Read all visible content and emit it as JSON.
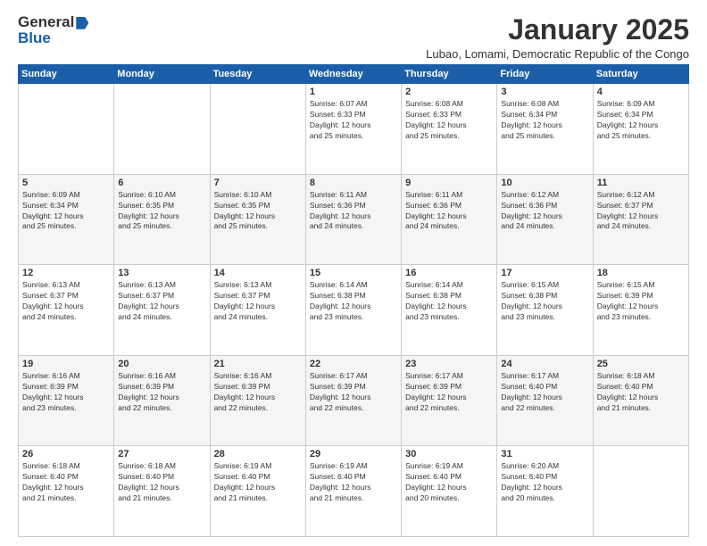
{
  "header": {
    "logo_general": "General",
    "logo_blue": "Blue",
    "title": "January 2025",
    "subtitle": "Lubao, Lomami, Democratic Republic of the Congo"
  },
  "calendar": {
    "days_of_week": [
      "Sunday",
      "Monday",
      "Tuesday",
      "Wednesday",
      "Thursday",
      "Friday",
      "Saturday"
    ],
    "weeks": [
      [
        {
          "day": "",
          "info": ""
        },
        {
          "day": "",
          "info": ""
        },
        {
          "day": "",
          "info": ""
        },
        {
          "day": "1",
          "info": "Sunrise: 6:07 AM\nSunset: 6:33 PM\nDaylight: 12 hours\nand 25 minutes."
        },
        {
          "day": "2",
          "info": "Sunrise: 6:08 AM\nSunset: 6:33 PM\nDaylight: 12 hours\nand 25 minutes."
        },
        {
          "day": "3",
          "info": "Sunrise: 6:08 AM\nSunset: 6:34 PM\nDaylight: 12 hours\nand 25 minutes."
        },
        {
          "day": "4",
          "info": "Sunrise: 6:09 AM\nSunset: 6:34 PM\nDaylight: 12 hours\nand 25 minutes."
        }
      ],
      [
        {
          "day": "5",
          "info": "Sunrise: 6:09 AM\nSunset: 6:34 PM\nDaylight: 12 hours\nand 25 minutes."
        },
        {
          "day": "6",
          "info": "Sunrise: 6:10 AM\nSunset: 6:35 PM\nDaylight: 12 hours\nand 25 minutes."
        },
        {
          "day": "7",
          "info": "Sunrise: 6:10 AM\nSunset: 6:35 PM\nDaylight: 12 hours\nand 25 minutes."
        },
        {
          "day": "8",
          "info": "Sunrise: 6:11 AM\nSunset: 6:36 PM\nDaylight: 12 hours\nand 24 minutes."
        },
        {
          "day": "9",
          "info": "Sunrise: 6:11 AM\nSunset: 6:36 PM\nDaylight: 12 hours\nand 24 minutes."
        },
        {
          "day": "10",
          "info": "Sunrise: 6:12 AM\nSunset: 6:36 PM\nDaylight: 12 hours\nand 24 minutes."
        },
        {
          "day": "11",
          "info": "Sunrise: 6:12 AM\nSunset: 6:37 PM\nDaylight: 12 hours\nand 24 minutes."
        }
      ],
      [
        {
          "day": "12",
          "info": "Sunrise: 6:13 AM\nSunset: 6:37 PM\nDaylight: 12 hours\nand 24 minutes."
        },
        {
          "day": "13",
          "info": "Sunrise: 6:13 AM\nSunset: 6:37 PM\nDaylight: 12 hours\nand 24 minutes."
        },
        {
          "day": "14",
          "info": "Sunrise: 6:13 AM\nSunset: 6:37 PM\nDaylight: 12 hours\nand 24 minutes."
        },
        {
          "day": "15",
          "info": "Sunrise: 6:14 AM\nSunset: 6:38 PM\nDaylight: 12 hours\nand 23 minutes."
        },
        {
          "day": "16",
          "info": "Sunrise: 6:14 AM\nSunset: 6:38 PM\nDaylight: 12 hours\nand 23 minutes."
        },
        {
          "day": "17",
          "info": "Sunrise: 6:15 AM\nSunset: 6:38 PM\nDaylight: 12 hours\nand 23 minutes."
        },
        {
          "day": "18",
          "info": "Sunrise: 6:15 AM\nSunset: 6:39 PM\nDaylight: 12 hours\nand 23 minutes."
        }
      ],
      [
        {
          "day": "19",
          "info": "Sunrise: 6:16 AM\nSunset: 6:39 PM\nDaylight: 12 hours\nand 23 minutes."
        },
        {
          "day": "20",
          "info": "Sunrise: 6:16 AM\nSunset: 6:39 PM\nDaylight: 12 hours\nand 22 minutes."
        },
        {
          "day": "21",
          "info": "Sunrise: 6:16 AM\nSunset: 6:39 PM\nDaylight: 12 hours\nand 22 minutes."
        },
        {
          "day": "22",
          "info": "Sunrise: 6:17 AM\nSunset: 6:39 PM\nDaylight: 12 hours\nand 22 minutes."
        },
        {
          "day": "23",
          "info": "Sunrise: 6:17 AM\nSunset: 6:39 PM\nDaylight: 12 hours\nand 22 minutes."
        },
        {
          "day": "24",
          "info": "Sunrise: 6:17 AM\nSunset: 6:40 PM\nDaylight: 12 hours\nand 22 minutes."
        },
        {
          "day": "25",
          "info": "Sunrise: 6:18 AM\nSunset: 6:40 PM\nDaylight: 12 hours\nand 21 minutes."
        }
      ],
      [
        {
          "day": "26",
          "info": "Sunrise: 6:18 AM\nSunset: 6:40 PM\nDaylight: 12 hours\nand 21 minutes."
        },
        {
          "day": "27",
          "info": "Sunrise: 6:18 AM\nSunset: 6:40 PM\nDaylight: 12 hours\nand 21 minutes."
        },
        {
          "day": "28",
          "info": "Sunrise: 6:19 AM\nSunset: 6:40 PM\nDaylight: 12 hours\nand 21 minutes."
        },
        {
          "day": "29",
          "info": "Sunrise: 6:19 AM\nSunset: 6:40 PM\nDaylight: 12 hours\nand 21 minutes."
        },
        {
          "day": "30",
          "info": "Sunrise: 6:19 AM\nSunset: 6:40 PM\nDaylight: 12 hours\nand 20 minutes."
        },
        {
          "day": "31",
          "info": "Sunrise: 6:20 AM\nSunset: 6:40 PM\nDaylight: 12 hours\nand 20 minutes."
        },
        {
          "day": "",
          "info": ""
        }
      ]
    ]
  }
}
